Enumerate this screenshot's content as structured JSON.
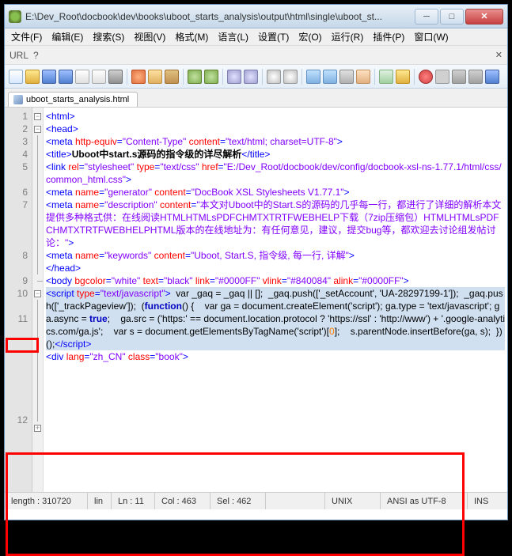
{
  "title": "E:\\Dev_Root\\docbook\\dev\\books\\uboot_starts_analysis\\output\\html\\single\\uboot_st...",
  "menu": [
    "文件(F)",
    "编辑(E)",
    "搜索(S)",
    "视图(V)",
    "格式(M)",
    "语言(L)",
    "设置(T)",
    "宏(O)",
    "运行(R)",
    "插件(P)",
    "窗口(W)"
  ],
  "url_label": "URL",
  "url_help": "?",
  "tab_name": "uboot_starts_analysis.html",
  "gutter_lines": [
    "1",
    "2",
    "3",
    "4",
    "5",
    "6",
    "7",
    "",
    "8",
    "",
    "",
    "",
    "9",
    "10",
    "",
    "11",
    "",
    "",
    "",
    "",
    "",
    "",
    "",
    "12"
  ],
  "code": {
    "l1": {
      "a": "<html>"
    },
    "l2": {
      "a": "<head>"
    },
    "l3": {
      "a": "<meta ",
      "b": "http-equiv",
      "c": "=",
      "d": "\"Content-Type\"",
      "e": " content",
      "f": "=",
      "g": "\"text/html; charset=UTF-8\"",
      "h": ">"
    },
    "l4": {
      "a": "<title>",
      "b": "Uboot中start.s源码的指令级的详尽解析",
      "c": "</title>"
    },
    "l5": {
      "a": "<link ",
      "b": "rel",
      "c": "=",
      "d": "\"stylesheet\"",
      "e": " type",
      "f": "=",
      "g": "\"text/css\"",
      "h": " href",
      "i": "=",
      "j": "\"E:/Dev_Root/docbook/dev/config/docbook-xsl-ns-1.77.1/html/css/common_html.css\"",
      "k": ">"
    },
    "l6": {
      "a": "<meta ",
      "b": "name",
      "c": "=",
      "d": "\"generator\"",
      "e": " content",
      "f": "=",
      "g": "\"DocBook XSL Stylesheets V1.77.1\"",
      "h": ">"
    },
    "l7": {
      "a": "<meta ",
      "b": "name",
      "c": "=",
      "d": "\"description\"",
      "e": " content",
      "f": "=",
      "g": "\"本文对Uboot中的Start.S的源码的几乎每一行，都进行了详细的解析本文提供多种格式供：在线阅读HTMLHTMLsPDFCHMTXTRTFWEBHELP下载（7zip压缩包）HTMLHTMLsPDFCHMTXTRTFWEBHELPHTML版本的在线地址为：有任何意见，建议，提交bug等，都欢迎去讨论组发帖讨论：\"",
      "h": ">"
    },
    "l8": {
      "a": "<meta ",
      "b": "name",
      "c": "=",
      "d": "\"keywords\"",
      "e": " content",
      "f": "=",
      "g": "\"Uboot, Start.S, 指令级, 每一行, 详解\"",
      "h": ">"
    },
    "l9": {
      "a": "</head>"
    },
    "l10": {
      "a": "<body ",
      "b": "bgcolor",
      "c": "=",
      "d": "\"white\"",
      "e": " text",
      "f": "=",
      "g": "\"black\"",
      "h": " link",
      "i": "=",
      "j": "\"#0000FF\"",
      "k": " vlink",
      "l": "=",
      "m": "\"#840084\"",
      "n": " alink",
      "o": "=",
      "p": "\"#0000FF\"",
      "q": ">"
    },
    "l11": {
      "a": "<script ",
      "b": "type",
      "c": "=",
      "d": "\"text/javascript\"",
      "e": ">",
      "f": "  var _gaq = _gaq || [];  _gaq.push(['_setAccount', 'UA-28297199-1']);  _gaq.push(['_trackPageview']);  (",
      "g": "function",
      "h": "() {    var ga = document.createElement('script'); ga.type = 'text/javascript'; ga.async = ",
      "i": "true",
      "j": ";    ga.src = ('https:' == document.location.protocol ? 'https://ssl' : 'http://www') + '.google-analytics.com/ga.js';    var s = document.getElementsByTagName('script')[",
      "k": "0",
      "l": "];    s.parentNode.insertBefore(ga, s);  })();",
      "m": "</script>"
    },
    "l12": {
      "a": "<div ",
      "b": "lang",
      "c": "=",
      "d": "\"zh_CN\"",
      "e": " class",
      "f": "=",
      "g": "\"book\"",
      "h": ">"
    }
  },
  "status": {
    "length": "length : 310720",
    "lines": "lin",
    "ln": "Ln : 11",
    "col": "Col : 463",
    "sel": "Sel : 462",
    "eol": "UNIX",
    "enc": "ANSI as UTF-8",
    "mode": "INS"
  }
}
